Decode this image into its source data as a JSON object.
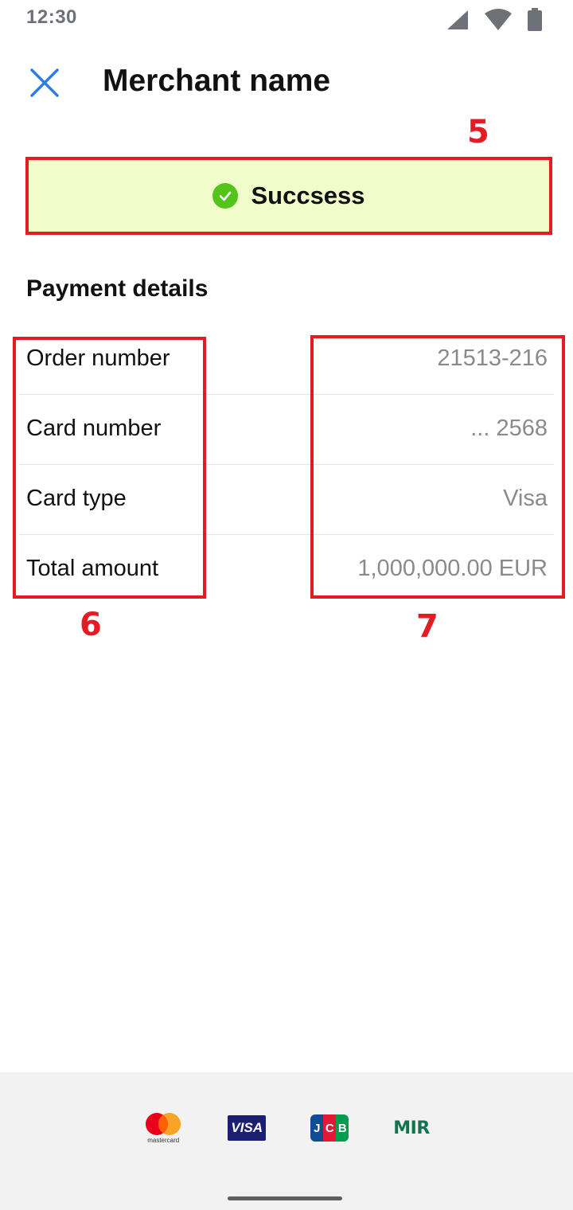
{
  "status_bar": {
    "time": "12:30"
  },
  "header": {
    "title": "Merchant name"
  },
  "annotations": {
    "banner": "5",
    "labels": "6",
    "values": "7"
  },
  "banner": {
    "text": "Succsess",
    "accent_color": "#52c41a",
    "background": "#f0fdcb"
  },
  "section_title": "Payment details",
  "details": [
    {
      "label": "Order number",
      "value": "21513-216"
    },
    {
      "label": "Card number",
      "value": "... 2568"
    },
    {
      "label": "Card type",
      "value": "Visa"
    },
    {
      "label": "Total amount",
      "value": "1,000,000.00 EUR"
    }
  ],
  "footer": {
    "logos": {
      "mastercard": "mastercard",
      "visa": "VISA",
      "jcb": [
        "J",
        "C",
        "B"
      ],
      "mir": "MIR"
    }
  },
  "colors": {
    "close_icon": "#2f7de1",
    "annotation": "#e51b23"
  }
}
